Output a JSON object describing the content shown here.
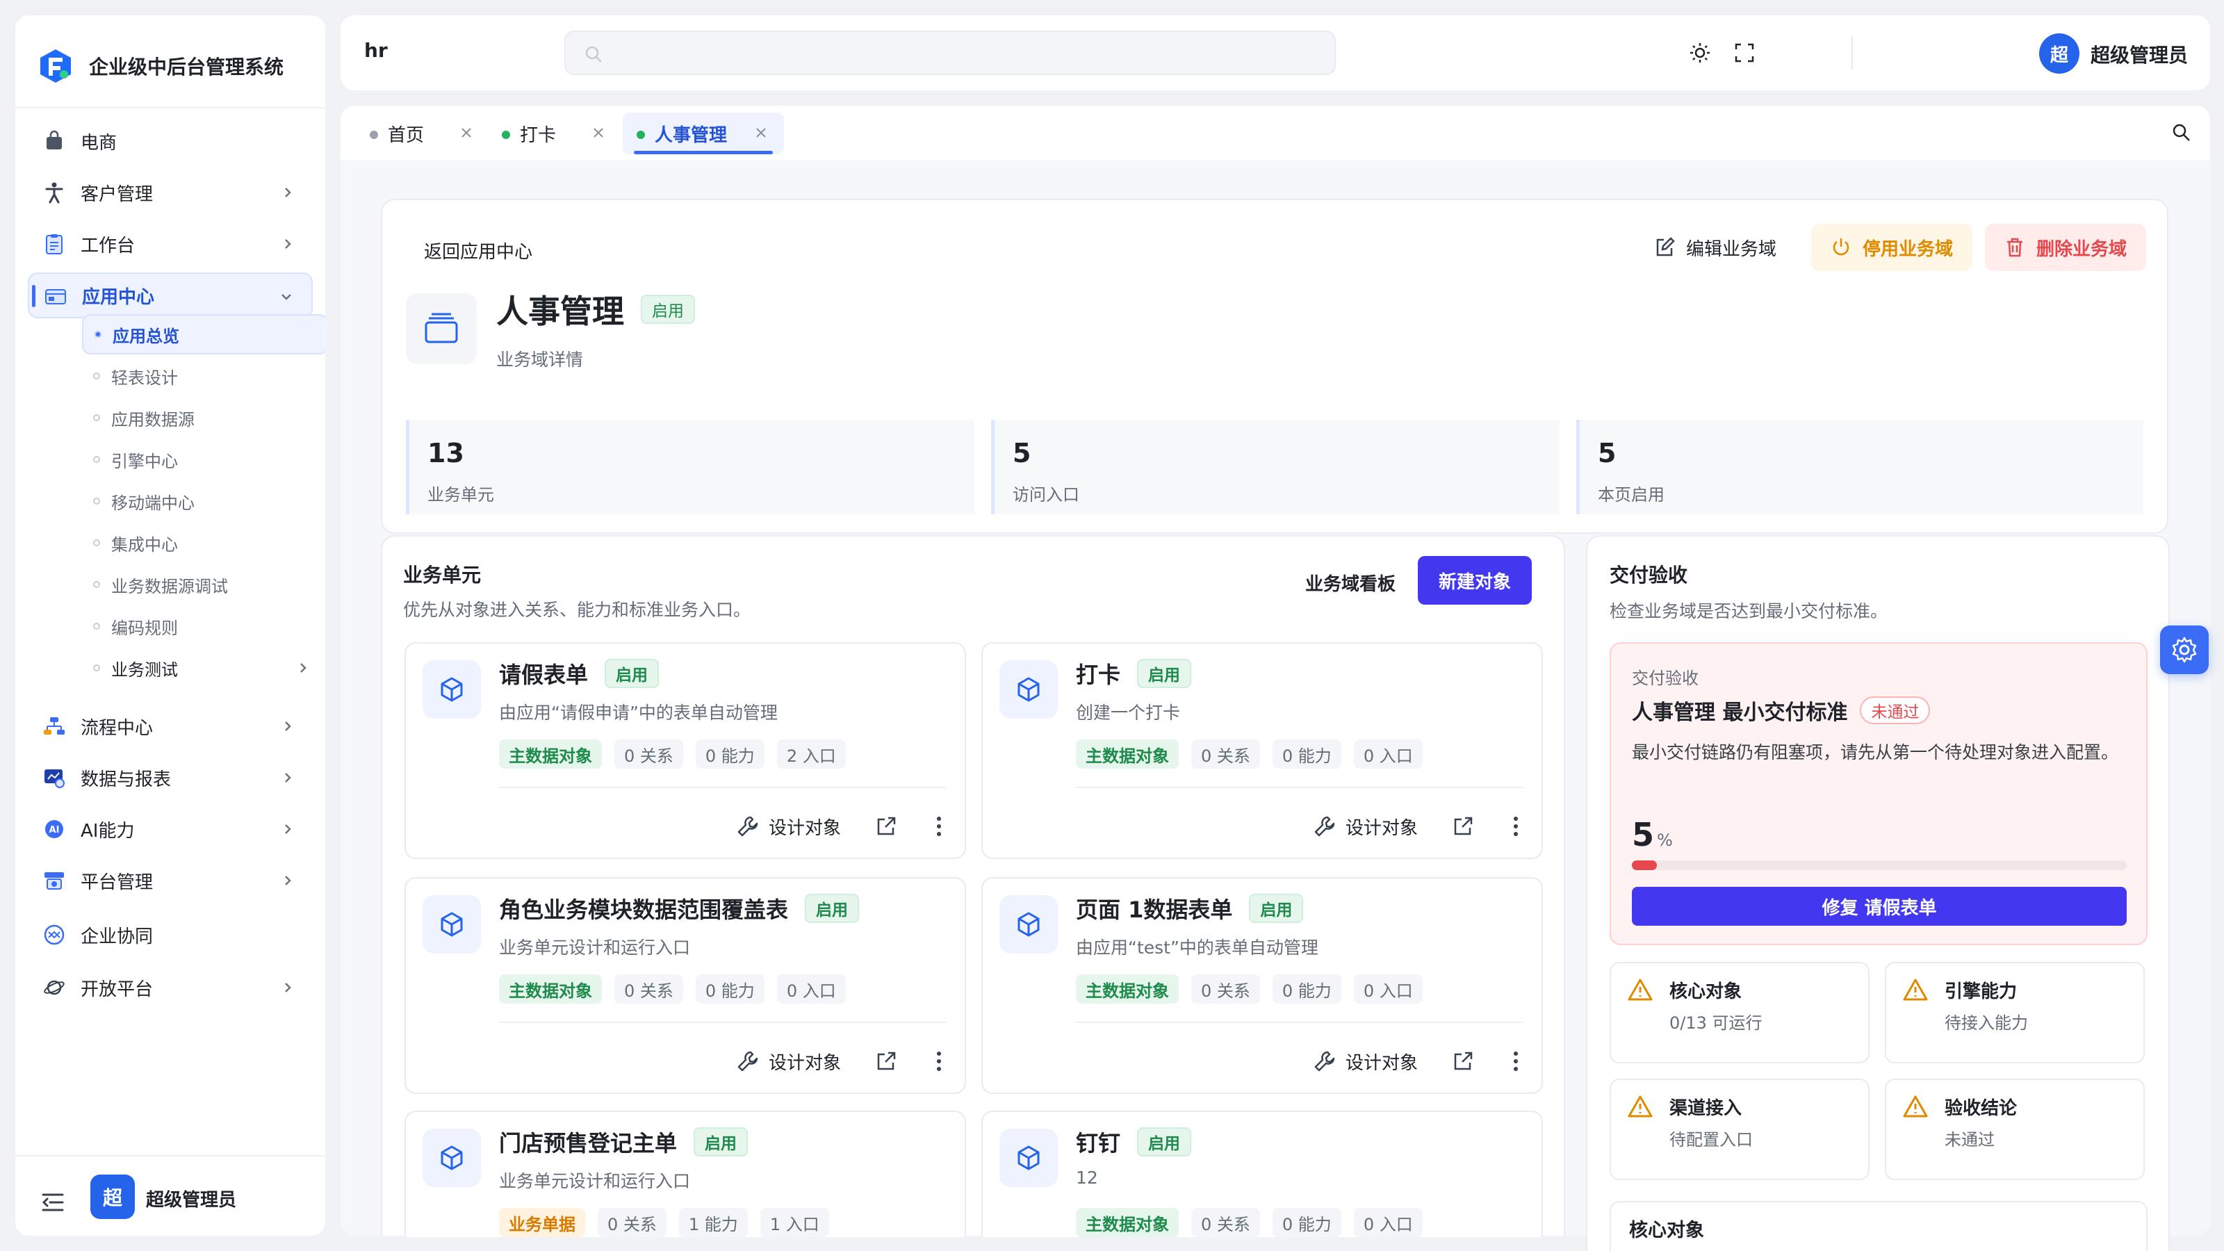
{
  "app": {
    "title": "企业级中后台管理系统"
  },
  "sidebar": {
    "items": [
      {
        "label": "电商",
        "icon": "shopping-bag-icon",
        "has_children": false
      },
      {
        "label": "客户管理",
        "icon": "person-icon",
        "has_children": true
      },
      {
        "label": "工作台",
        "icon": "clipboard-icon",
        "has_children": true
      },
      {
        "label": "应用中心",
        "icon": "app-window-icon",
        "has_children": true,
        "expanded": true,
        "active": true
      },
      {
        "label": "流程中心",
        "icon": "flow-icon",
        "has_children": true
      },
      {
        "label": "数据与报表",
        "icon": "report-icon",
        "has_children": true
      },
      {
        "label": "AI能力",
        "icon": "ai-icon",
        "has_children": true
      },
      {
        "label": "平台管理",
        "icon": "platform-icon",
        "has_children": true
      },
      {
        "label": "企业协同",
        "icon": "collaboration-icon",
        "has_children": false
      },
      {
        "label": "开放平台",
        "icon": "planet-icon",
        "has_children": true
      }
    ],
    "sub_items": [
      {
        "label": "应用总览",
        "active": true
      },
      {
        "label": "轻表设计"
      },
      {
        "label": "应用数据源"
      },
      {
        "label": "引擎中心"
      },
      {
        "label": "移动端中心"
      },
      {
        "label": "集成中心"
      },
      {
        "label": "业务数据源调试"
      },
      {
        "label": "编码规则"
      },
      {
        "label": "业务测试",
        "has_children": true
      }
    ],
    "footer": {
      "avatar": "超",
      "user": "超级管理员"
    }
  },
  "header": {
    "breadcrumb": "hr",
    "search_placeholder": "",
    "avatar": "超",
    "user": "超级管理员"
  },
  "tabs": [
    {
      "label": "首页",
      "dot_color": "#9aa1ab"
    },
    {
      "label": "打卡",
      "dot_color": "#22b35e"
    },
    {
      "label": "人事管理",
      "dot_color": "#22b35e",
      "active": true
    }
  ],
  "domain": {
    "back": "返回应用中心",
    "title": "人事管理",
    "status": "启用",
    "subtitle": "业务域详情",
    "actions": {
      "edit": "编辑业务域",
      "disable": "停用业务域",
      "delete": "删除业务域"
    },
    "stats": [
      {
        "value": "13",
        "label": "业务单元"
      },
      {
        "value": "5",
        "label": "访问入口"
      },
      {
        "value": "5",
        "label": "本页启用"
      }
    ]
  },
  "units": {
    "title": "业务单元",
    "subtitle": "优先从对象进入关系、能力和标准业务入口。",
    "board_label": "业务域看板",
    "new_label": "新建对象",
    "design_label": "设计对象",
    "cards": [
      {
        "name": "请假表单",
        "status": "启用",
        "desc": "由应用“请假申请”中的表单自动管理",
        "type": "主数据对象",
        "type_kind": "main",
        "relations": "0 关系",
        "abilities": "0 能力",
        "entries": "2 入口"
      },
      {
        "name": "打卡",
        "status": "启用",
        "desc": "创建一个打卡",
        "type": "主数据对象",
        "type_kind": "main",
        "relations": "0 关系",
        "abilities": "0 能力",
        "entries": "0 入口"
      },
      {
        "name": "角色业务模块数据范围覆盖表",
        "status": "启用",
        "desc": "业务单元设计和运行入口",
        "type": "主数据对象",
        "type_kind": "main",
        "relations": "0 关系",
        "abilities": "0 能力",
        "entries": "0 入口"
      },
      {
        "name": "页面 1数据表单",
        "status": "启用",
        "desc": "由应用“test”中的表单自动管理",
        "type": "主数据对象",
        "type_kind": "main",
        "relations": "0 关系",
        "abilities": "0 能力",
        "entries": "0 入口"
      },
      {
        "name": "门店预售登记主单",
        "status": "启用",
        "desc": "业务单元设计和运行入口",
        "type": "业务单据",
        "type_kind": "warn",
        "relations": "0 关系",
        "abilities": "1 能力",
        "entries": "1 入口"
      },
      {
        "name": "钉钉",
        "status": "启用",
        "desc": "12",
        "type": "主数据对象",
        "type_kind": "main",
        "relations": "0 关系",
        "abilities": "0 能力",
        "entries": "0 入口"
      }
    ]
  },
  "delivery": {
    "title": "交付验收",
    "subtitle": "检查业务域是否达到最小交付标准。",
    "card": {
      "label": "交付验收",
      "title": "人事管理 最小交付标准",
      "status": "未通过",
      "desc": "最小交付链路仍有阻塞项，请先从第一个待处理对象进入配置。",
      "percent": "5",
      "percent_unit": "%",
      "progress": 0.05,
      "button": "修复 请假表单"
    },
    "checks": [
      {
        "title": "核心对象",
        "sub": "0/13 可运行"
      },
      {
        "title": "引擎能力",
        "sub": "待接入能力"
      },
      {
        "title": "渠道接入",
        "sub": "待配置入口"
      },
      {
        "title": "验收结论",
        "sub": "未通过"
      }
    ],
    "next_section": "核心对象"
  },
  "colors": {
    "primary": "#4338f0",
    "accent": "#2563eb",
    "success": "#1e8b4c",
    "warning": "#e08a00",
    "danger": "#e5484d"
  }
}
